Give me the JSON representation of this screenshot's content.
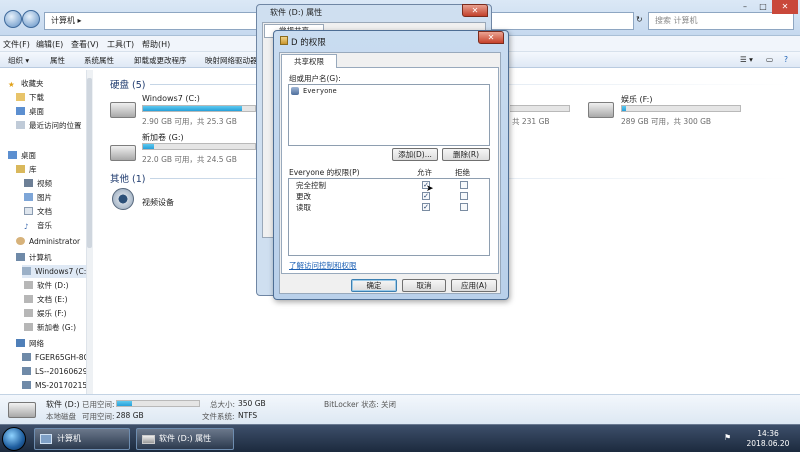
{
  "explorer": {
    "address": "计算机  ▸",
    "search_placeholder": "搜索 计算机",
    "menu": [
      "文件(F)",
      "编辑(E)",
      "查看(V)",
      "工具(T)",
      "帮助(H)"
    ],
    "toolbar": [
      "组织 ▾",
      "属性",
      "系统属性",
      "卸载或更改程序",
      "映射网络驱动器"
    ],
    "sidebar": {
      "favorites": "收藏夹",
      "favorites_items": [
        "下载",
        "桌面",
        "最近访问的位置"
      ],
      "desktop": "桌面",
      "library": "库",
      "library_items": [
        "视频",
        "图片",
        "文档",
        "音乐"
      ],
      "admin": "Administrator",
      "computer": "计算机",
      "computer_items": [
        "Windows7 (C:",
        "软件 (D:)",
        "文档 (E:)",
        "娱乐 (F:)",
        "新加卷 (G:)"
      ],
      "network": "网络",
      "network_items": [
        "FGER65GH-8C",
        "LS--20160629",
        "MS-20170215"
      ]
    },
    "groups": {
      "disks": "硬盘 (5)",
      "other": "其他 (1)"
    },
    "drives": [
      {
        "name": "Windows7 (C:)",
        "info": "2.90 GB 可用，共 25.3 GB",
        "used_fraction": 0.885
      },
      {
        "name": "新加卷 (G:)",
        "info": "22.0 GB 可用，共 24.5 GB",
        "used_fraction": 0.1
      },
      {
        "name": "娱乐 (F:)",
        "info": "289 GB 可用，共 300 GB",
        "used_fraction": 0.037
      }
    ],
    "partial_drive_info": "共 231 GB",
    "other_device": "视频设备",
    "details": {
      "name": "软件 (D:)",
      "type": "本地磁盘",
      "used_label": "已用空间:",
      "free_label": "可用空间:",
      "free_value": "288 GB",
      "used_fraction": 0.18,
      "total_label": "总大小:",
      "total_value": "350 GB",
      "fs_label": "文件系统:",
      "fs_value": "NTFS",
      "bitlocker": "BitLocker 状态: 关闭"
    }
  },
  "properties_window": {
    "title": "软件 (D:) 属性",
    "tab": "常规共享",
    "close": "✕"
  },
  "permissions_dialog": {
    "title": "D 的权限",
    "close": "✕",
    "tab": "共享权限",
    "users_label": "组或用户名(G):",
    "users": [
      "Everyone"
    ],
    "add_button": "添加(D)...",
    "remove_button": "删除(R)",
    "perm_label": "Everyone 的权限(P)",
    "allow_header": "允许",
    "deny_header": "拒绝",
    "permissions": [
      {
        "name": "完全控制",
        "allow": true,
        "deny": false
      },
      {
        "name": "更改",
        "allow": true,
        "deny": false
      },
      {
        "name": "读取",
        "allow": true,
        "deny": false
      }
    ],
    "link": "了解访问控制和权限",
    "ok": "确定",
    "cancel": "取消",
    "apply": "应用(A)"
  },
  "taskbar": {
    "items": [
      "计算机",
      "软件 (D:) 属性"
    ],
    "time": "14:36",
    "date": "2018.06.20"
  },
  "colors": {
    "accent": "#26a0da",
    "link": "#1a5fb4"
  }
}
